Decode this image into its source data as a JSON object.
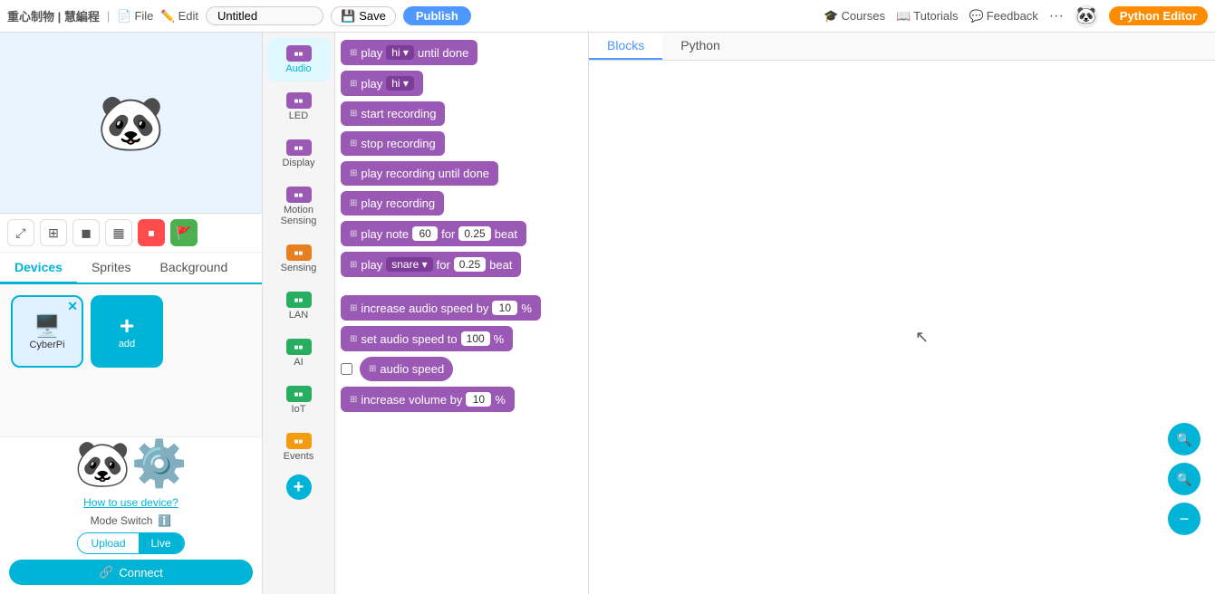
{
  "nav": {
    "brand": "重心制物 | 慧編程",
    "file": "File",
    "edit": "Edit",
    "title_placeholder": "Untitled",
    "save_label": "Save",
    "publish_label": "Publish",
    "courses_label": "Courses",
    "tutorials_label": "Tutorials",
    "feedback_label": "Feedback",
    "more": "···",
    "python_editor_label": "Python Editor"
  },
  "left_panel": {
    "tabs": [
      "Devices",
      "Sprites",
      "Background"
    ],
    "active_tab": "Devices",
    "device_name": "CyberPi",
    "add_label": "add",
    "how_to_link": "How to use device?",
    "mode_switch_label": "Mode Switch",
    "upload_label": "Upload",
    "live_label": "Live",
    "connect_label": "Connect"
  },
  "categories": [
    {
      "name": "Audio",
      "color": "#9b59b6"
    },
    {
      "name": "LED",
      "color": "#9b59b6"
    },
    {
      "name": "Display",
      "color": "#9b59b6"
    },
    {
      "name": "Motion Sensing",
      "color": "#9b59b6"
    },
    {
      "name": "Sensing",
      "color": "#e67e22"
    },
    {
      "name": "LAN",
      "color": "#27ae60"
    },
    {
      "name": "AI",
      "color": "#27ae60"
    },
    {
      "name": "IoT",
      "color": "#27ae60"
    },
    {
      "name": "Events",
      "color": "#f39c12"
    }
  ],
  "blocks": [
    {
      "id": "play_hi_until_done",
      "text": "play",
      "parts": [
        "dropdown:hi",
        "until done"
      ]
    },
    {
      "id": "play_hi",
      "text": "play",
      "parts": [
        "dropdown:hi"
      ]
    },
    {
      "id": "start_recording",
      "text": "start recording",
      "parts": []
    },
    {
      "id": "stop_recording",
      "text": "stop recording",
      "parts": []
    },
    {
      "id": "play_recording_until_done",
      "text": "play recording until done",
      "parts": []
    },
    {
      "id": "play_recording",
      "text": "play recording",
      "parts": []
    },
    {
      "id": "play_note",
      "text": "play note",
      "parts": [
        "input:60",
        "for",
        "input:0.25",
        "beat"
      ]
    },
    {
      "id": "play_snare",
      "text": "play",
      "parts": [
        "dropdown:snare",
        "for",
        "input:0.25",
        "beat"
      ]
    },
    {
      "id": "increase_audio_speed",
      "text": "increase audio speed by",
      "parts": [
        "input:10",
        "%"
      ]
    },
    {
      "id": "set_audio_speed",
      "text": "set audio speed to",
      "parts": [
        "input:100",
        "%"
      ]
    },
    {
      "id": "audio_speed",
      "text": "audio speed",
      "parts": [],
      "has_checkbox": true,
      "reporter": true
    },
    {
      "id": "increase_volume",
      "text": "increase volume by",
      "parts": [
        "input:10",
        "%"
      ]
    }
  ],
  "workspace_tabs": [
    {
      "label": "Blocks",
      "active": true
    },
    {
      "label": "Python",
      "active": false
    }
  ],
  "zoom_buttons": [
    {
      "icon": "🔍",
      "label": "zoom-in"
    },
    {
      "icon": "🔍",
      "label": "zoom-fit"
    },
    {
      "icon": "➖",
      "label": "zoom-out"
    }
  ]
}
